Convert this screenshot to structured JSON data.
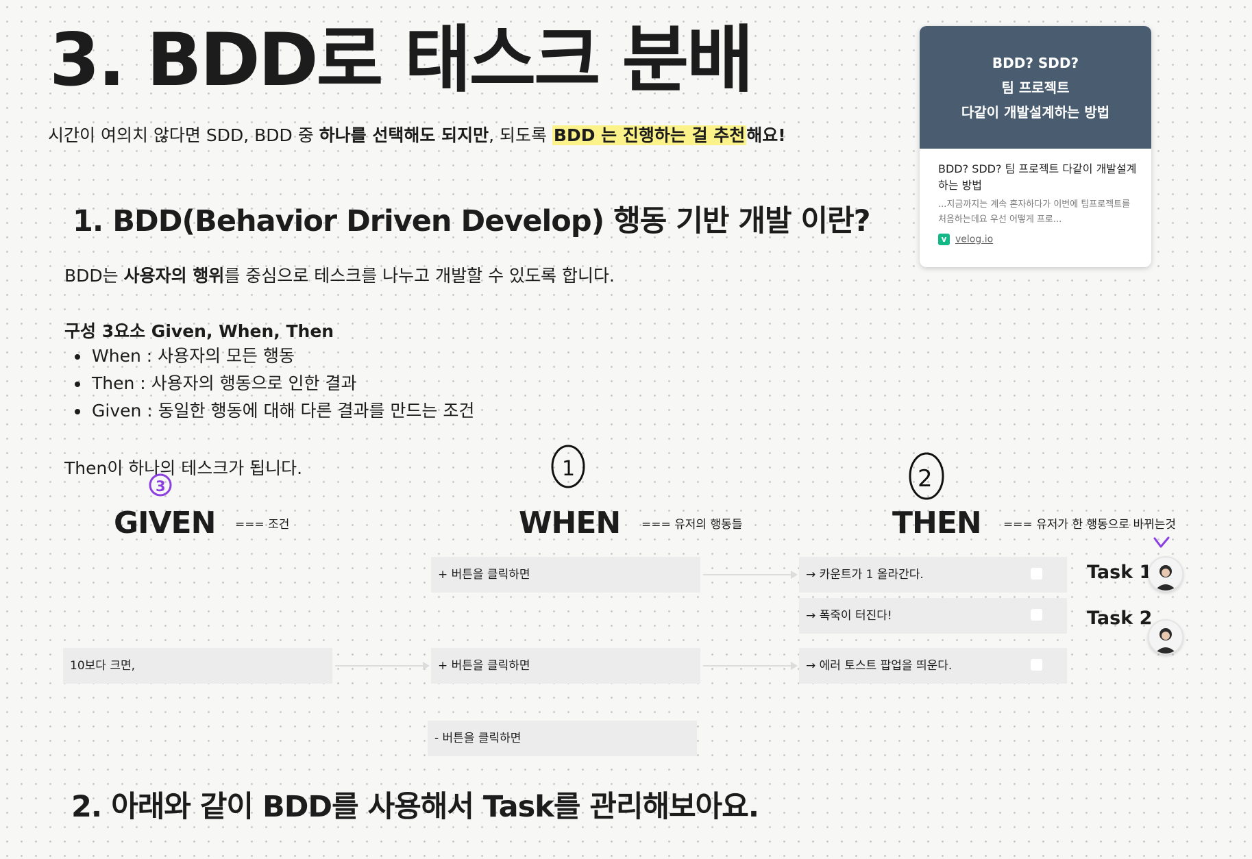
{
  "title": "3. BDD로 태스크 분배",
  "subtitle": {
    "part1": "시간이 여의치 않다면 SDD, BDD 중 ",
    "bold1": "하나를 선택해도 되지만",
    "part2": ", 되도록 ",
    "highlight": "BDD 는 진행하는 걸 추천",
    "part3": "해요!"
  },
  "section1": {
    "heading": "1. BDD(Behavior Driven Develop) 행동 기반 개발 이란?",
    "intro": {
      "before": "BDD는 ",
      "bold": "사용자의 행위",
      "after": "를 중심으로 테스크를 나누고 개발할 수 있도록 합니다."
    },
    "components_title": "구성 3요소 Given, When, Then",
    "components": [
      "When : 사용자의 모든 행동",
      "Then : 사용자의 행동으로 인한 결과",
      "Given : 동일한 행동에 대해 다른 결과를 만드는 조건"
    ],
    "then_note": "Then이 하나의 테스크가 됩니다."
  },
  "board": {
    "columns": {
      "given": {
        "label": "GIVEN",
        "note": "=== 조건",
        "marker": "3"
      },
      "when": {
        "label": "WHEN",
        "note": "=== 유저의 행동들",
        "marker": "1"
      },
      "then": {
        "label": "THEN",
        "note": "=== 유저가 한 행동으로 바뀌는것",
        "marker": "2"
      }
    },
    "cards": {
      "when1": "+ 버튼을 클릭하면",
      "then1": "→ 카운트가 1 올라간다.",
      "then2": "→ 폭죽이 터진다!",
      "given1": "10보다 크면,",
      "when2": "+ 버튼을 클릭하면",
      "then3": "→ 에러 토스트 팝업을 띄운다.",
      "when3": "- 버튼을 클릭하면"
    },
    "tasks": [
      "Task 1",
      "Task 2"
    ]
  },
  "link_card": {
    "banner_lines": [
      "BDD? SDD?",
      "팀 프로젝트",
      "다같이 개발설계하는 방법"
    ],
    "title": "BDD? SDD? 팀 프로젝트 다같이 개발설계하는 방법",
    "description": "...지금까지는 계속 혼자하다가 이번에 팀프로젝트를처음하는데요 우선 어떻게 프로...",
    "source_icon": "v",
    "source": "velog.io"
  },
  "section2": {
    "heading": "2. 아래와 같이 BDD를 사용해서 Task를 관리해보아요."
  },
  "colors": {
    "highlight": "#fbf28a",
    "banner": "#4a5d70",
    "annotation_purple": "#8b3fe0",
    "card": "#ececec"
  }
}
